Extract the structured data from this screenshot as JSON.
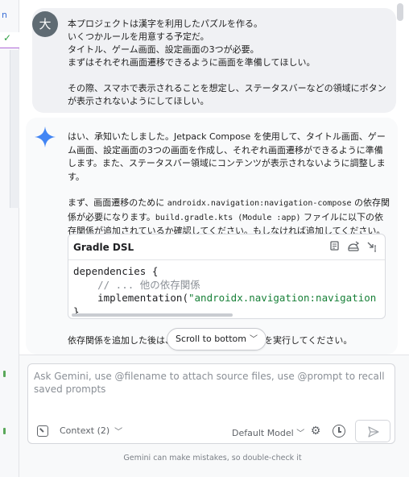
{
  "user_message": {
    "avatar_initial": "大",
    "text": "本プロジェクトは漢字を利用したパズルを作る。\nいくつかルールを用意する予定だ。\nタイトル、ゲーム画面、設定画面の3つが必要。\nまずはそれぞれ画面遷移できるように画面を準備してほしい。\n\nその際、スマホで表示されることを想定し、ステータスバーなどの領域にボタンが表示されないようにしてほしい。"
  },
  "ai_message": {
    "paragraph1": "はい、承知いたしました。Jetpack Compose を使用して、タイトル画面、ゲーム画面、設定画面の3つの画面を作成し、それぞれ画面遷移ができるように準備します。また、ステータスバー領域にコンテンツが表示されないように調整します。",
    "paragraph2_before": "まず、画面遷移のために ",
    "paragraph2_code1": "androidx.navigation:navigation-compose",
    "paragraph2_mid": " の依存関係が必要になります。",
    "paragraph2_code2": "build.gradle.kts (Module :app)",
    "paragraph2_after": " ファイルに以下の依存関係が追加されているか確認してください。もしなければ追加してください。",
    "code_block": {
      "title": "Gradle DSL",
      "line1": "dependencies {",
      "line2": "    // ... 他の依存関係",
      "line3_prefix": "    implementation(",
      "line3_string": "\"androidx.navigation:navigation",
      "line4": "}"
    },
    "after_text": "依存関係を追加した後は、",
    "after_text_end": "を実行してください。"
  },
  "scroll_pill": {
    "label": "Scroll to bottom"
  },
  "input": {
    "placeholder": "Ask Gemini, use @filename to attach source files, use @prompt to recall saved prompts",
    "context_label": "Context (2)",
    "model_label": "Default Model"
  },
  "disclaimer": "Gemini can make mistakes, so double-check it",
  "left_strip": {
    "top_label": "n"
  },
  "colors": {
    "accent": "#4285f4",
    "string": "#188038",
    "comment": "#8a8f96"
  }
}
